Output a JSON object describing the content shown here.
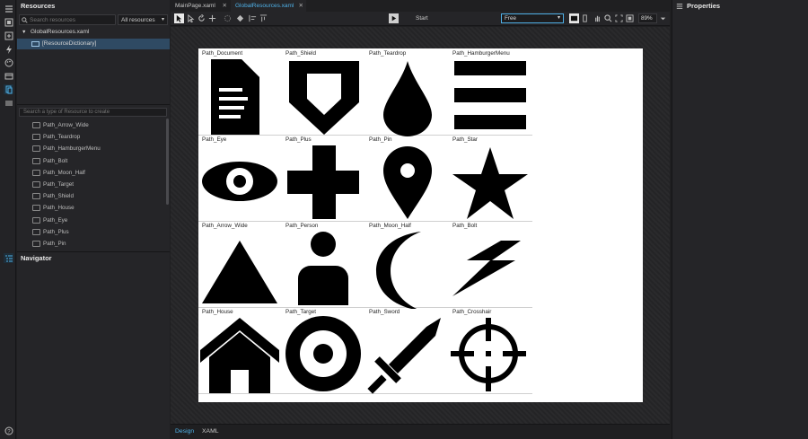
{
  "left_panel": {
    "resources_title": "Resources",
    "search_placeholder": "Search resources",
    "filter_value": "All resources",
    "tree": {
      "file": "GlobalResources.xaml",
      "dictionary": "[ResourceDictionary]"
    },
    "create_placeholder": "Search a type of Resource to create",
    "resource_types": [
      "Path_Arrow_Wide",
      "Path_Teardrop",
      "Path_HamburgerMenu",
      "Path_Bolt",
      "Path_Moon_Half",
      "Path_Target",
      "Path_Shield",
      "Path_House",
      "Path_Eye",
      "Path_Plus",
      "Path_Pin"
    ],
    "navigator_title": "Navigator"
  },
  "tabs": [
    {
      "label": "MainPage.xaml"
    },
    {
      "label": "GlobalResources.xaml"
    }
  ],
  "toolbar": {
    "start_label": "Start",
    "mode_value": "Free",
    "zoom_value": "89%"
  },
  "paths": [
    {
      "label": "Path_Document",
      "icon": "document-icon"
    },
    {
      "label": "Path_Shield",
      "icon": "shield-icon"
    },
    {
      "label": "Path_Teardrop",
      "icon": "teardrop-icon"
    },
    {
      "label": "Path_HamburgerMenu",
      "icon": "hamburger-menu-icon"
    },
    {
      "label": "Path_Eye",
      "icon": "eye-icon"
    },
    {
      "label": "Path_Plus",
      "icon": "plus-icon"
    },
    {
      "label": "Path_Pin",
      "icon": "pin-icon"
    },
    {
      "label": "Path_Star",
      "icon": "star-icon"
    },
    {
      "label": "Path_Arrow_Wide",
      "icon": "arrow-wide-icon"
    },
    {
      "label": "Path_Person",
      "icon": "person-icon"
    },
    {
      "label": "Path_Moon_Half",
      "icon": "moon-half-icon"
    },
    {
      "label": "Path_Bolt",
      "icon": "bolt-icon"
    },
    {
      "label": "Path_House",
      "icon": "house-icon"
    },
    {
      "label": "Path_Target",
      "icon": "target-icon"
    },
    {
      "label": "Path_Sword",
      "icon": "sword-icon"
    },
    {
      "label": "Path_Crosshair",
      "icon": "crosshair-icon"
    }
  ],
  "bottom_tabs": {
    "design": "Design",
    "xaml": "XAML"
  },
  "right_panel": {
    "properties_title": "Properties"
  },
  "colors": {
    "accent": "#4fb1e8",
    "selection": "#2f4a63",
    "panel": "#252528",
    "canvas": "#ffffff"
  }
}
